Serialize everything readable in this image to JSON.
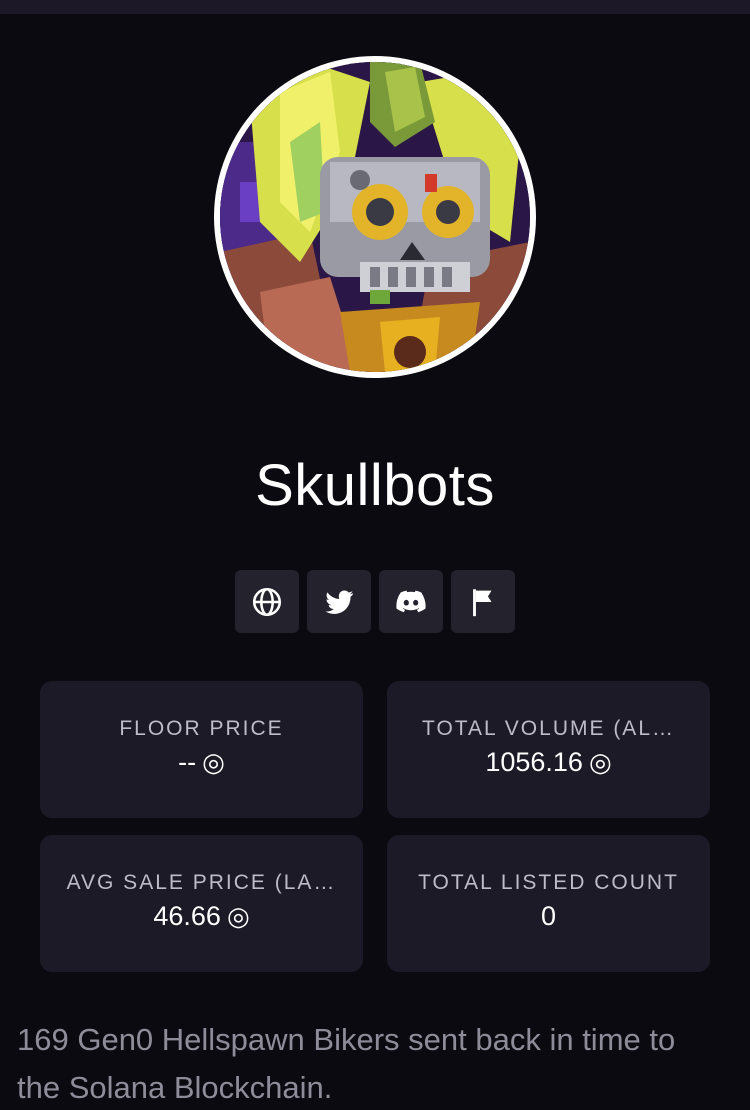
{
  "collection": {
    "name": "Skullbots",
    "avatar_alt": "Skullbots avatar"
  },
  "links": [
    {
      "name": "website",
      "icon": "globe-icon"
    },
    {
      "name": "twitter",
      "icon": "twitter-icon"
    },
    {
      "name": "discord",
      "icon": "discord-icon"
    },
    {
      "name": "report",
      "icon": "flag-icon"
    }
  ],
  "stats": {
    "floor_price": {
      "label": "FLOOR PRICE",
      "value": "--",
      "unit_icon": "sol-icon"
    },
    "total_volume": {
      "label": "TOTAL VOLUME (AL…",
      "value": "1056.16",
      "unit_icon": "sol-icon"
    },
    "avg_sale_price": {
      "label": "AVG SALE PRICE (LA…",
      "value": "46.66",
      "unit_icon": "sol-icon"
    },
    "total_listed": {
      "label": "TOTAL LISTED COUNT",
      "value": "0"
    }
  },
  "description": "169 Gen0 Hellspawn Bikers sent back in time to the Solana Blockchain.",
  "colors": {
    "background": "#0b0a10",
    "card": "#1b1a26",
    "button": "#24232d",
    "muted_text": "#8e8c98"
  }
}
